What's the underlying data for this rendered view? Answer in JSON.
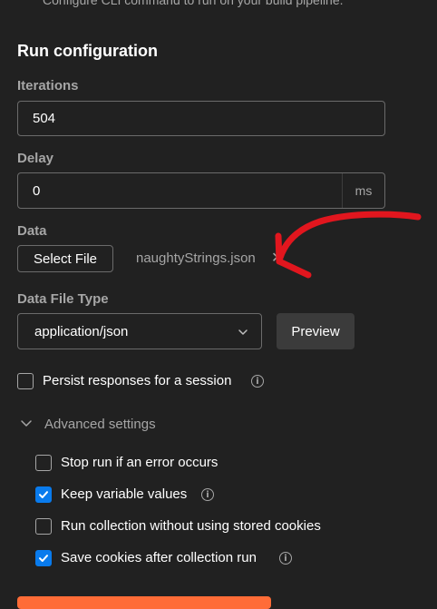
{
  "header": {
    "subtitle": "Configure CLI command to run on your build pipeline."
  },
  "run_config": {
    "title": "Run configuration",
    "iterations": {
      "label": "Iterations",
      "value": "504"
    },
    "delay": {
      "label": "Delay",
      "value": "0",
      "unit": "ms"
    },
    "data": {
      "label": "Data",
      "select_file_label": "Select File",
      "file_name": "naughtyStrings.json",
      "remove_symbol": "✕"
    },
    "data_file_type": {
      "label": "Data File Type",
      "selected": "application/json",
      "preview_label": "Preview"
    },
    "persist": {
      "label": "Persist responses for a session",
      "checked": false
    }
  },
  "advanced": {
    "label": "Advanced settings",
    "options": [
      {
        "label": "Stop run if an error occurs",
        "checked": false
      },
      {
        "label": "Keep variable values",
        "checked": true
      },
      {
        "label": "Run collection without using stored cookies",
        "checked": false
      },
      {
        "label": "Save cookies after collection run",
        "checked": true
      }
    ]
  },
  "colors": {
    "background": "#212121",
    "accent": "#097bed",
    "brand": "#ff6c37",
    "annotation_arrow": "#e1161e"
  },
  "icons": {
    "info": "info-circle-icon",
    "chevron": "chevron-down-icon",
    "annotation": "red-arrow-annotation-icon"
  }
}
